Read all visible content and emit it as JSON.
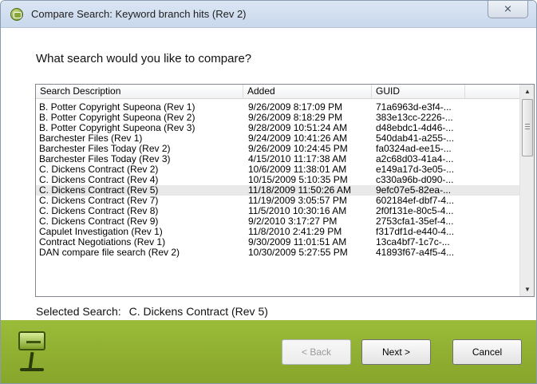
{
  "window": {
    "title": "Compare Search:  Keyword branch hits (Rev 2)",
    "close_glyph": "⨯"
  },
  "prompt": "What search would you like to compare?",
  "list": {
    "columns": [
      "Search Description",
      "Added",
      "GUID"
    ],
    "rows": [
      {
        "desc": "B. Potter Copyright Supeona (Rev 1)",
        "added": "9/26/2009 8:17:09 PM",
        "guid": "71a6963d-e3f4-..."
      },
      {
        "desc": "B. Potter Copyright Supeona (Rev 2)",
        "added": "9/26/2009 8:18:29 PM",
        "guid": "383e13cc-2226-..."
      },
      {
        "desc": "B. Potter Copyright Supeona (Rev 3)",
        "added": "9/28/2009 10:51:24 AM",
        "guid": "d48ebdc1-4d46-..."
      },
      {
        "desc": "Barchester Files (Rev 1)",
        "added": "9/24/2009 10:41:26 AM",
        "guid": "540dab41-a255-..."
      },
      {
        "desc": "Barchester Files Today (Rev 2)",
        "added": "9/26/2009 10:24:45 PM",
        "guid": "fa0324ad-ee15-..."
      },
      {
        "desc": "Barchester Files Today (Rev 3)",
        "added": "4/15/2010 11:17:38 AM",
        "guid": "a2c68d03-41a4-..."
      },
      {
        "desc": "C. Dickens Contract (Rev 2)",
        "added": "10/6/2009 11:38:01 AM",
        "guid": "e149a17d-3e05-..."
      },
      {
        "desc": "C. Dickens Contract (Rev 4)",
        "added": "10/15/2009 5:10:35 PM",
        "guid": "c330a96b-d090-..."
      },
      {
        "desc": "C. Dickens Contract (Rev 5)",
        "added": "11/18/2009 11:50:26 AM",
        "guid": "9efc07e5-82ea-...",
        "selected": true
      },
      {
        "desc": "C. Dickens Contract (Rev 7)",
        "added": "11/19/2009 3:05:57 PM",
        "guid": "602184ef-dbf7-4..."
      },
      {
        "desc": "C. Dickens Contract (Rev 8)",
        "added": "11/5/2010 10:30:16 AM",
        "guid": "2f0f131e-80c5-4..."
      },
      {
        "desc": "C. Dickens Contract (Rev 9)",
        "added": "9/2/2010 3:17:27 PM",
        "guid": "2753cfa1-35ef-4..."
      },
      {
        "desc": "Capulet Investigation (Rev 1)",
        "added": "11/8/2010 2:41:29 PM",
        "guid": "f317df1d-e440-4..."
      },
      {
        "desc": "Contract Negotiations (Rev 1)",
        "added": "9/30/2009 11:01:51 AM",
        "guid": "13ca4bf7-1c7c-..."
      },
      {
        "desc": "DAN compare file search (Rev 2)",
        "added": "10/30/2009 5:27:55 PM",
        "guid": "41893f67-a4f5-4..."
      }
    ],
    "scroll_up_glyph": "▲",
    "scroll_down_glyph": "▼"
  },
  "selected_search": {
    "label": "Selected Search:",
    "value": "C. Dickens Contract (Rev 5)"
  },
  "buttons": {
    "back": "< Back",
    "next": "Next >",
    "cancel": "Cancel"
  },
  "colors": {
    "footer": "#8cab2f",
    "selected_row": "#e9e9e9",
    "titlebar": "#d3e0f1"
  },
  "icons": {
    "app": "monitor-app-icon",
    "logo": "monitor-logo-icon"
  }
}
